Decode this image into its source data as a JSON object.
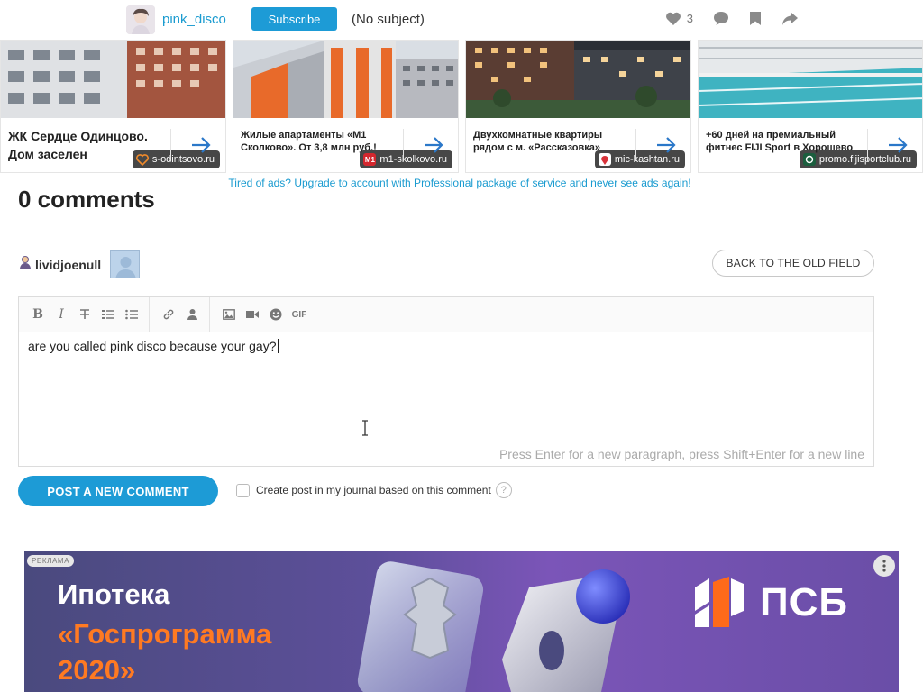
{
  "topbar": {
    "username": "pink_disco",
    "subscribe_label": "Subscribe",
    "subject": "(No subject)",
    "likes_count": "3"
  },
  "ads": [
    {
      "image": "building-facade",
      "source": "s-odintsovo.ru",
      "source_icon": "heart-outline-icon",
      "title": "ЖК Сердце Одинцово. Дом заселен"
    },
    {
      "image": "orange-buildings",
      "source": "m1-skolkovo.ru",
      "source_icon": "M1",
      "title": "Жилые апартаменты «М1 Сколково». От 3,8 млн руб.!"
    },
    {
      "image": "evening-courtyard",
      "source": "mic-kashtan.ru",
      "source_icon": "pin-icon",
      "title": "Двухкомнатные квартиры рядом с м. «Рассказовка»"
    },
    {
      "image": "swimming-pool",
      "source": "promo.fijisportclub.ru",
      "source_icon": "fiji-logo-icon",
      "title": "+60 дней на премиальный фитнес FIJI Sport в Хорошево"
    }
  ],
  "upgrade_text": "Tired of ads? Upgrade to account with Professional package of service and never see ads again!",
  "comments": {
    "heading": "0 comments"
  },
  "composer": {
    "author": "lividjoenull",
    "back_label": "BACK TO THE OLD FIELD",
    "toolbar": {
      "bold": "B",
      "italic": "I",
      "strike": "T",
      "gif": "GIF"
    },
    "text": "are you called pink disco because your gay?",
    "hint": "Press Enter for a new paragraph, press Shift+Enter for a new line",
    "post_label": "POST A NEW COMMENT",
    "checkbox_label": "Create post in my journal based on this comment",
    "help": "?"
  },
  "banner": {
    "tag": "РЕКЛАМА",
    "line1": "Ипотека",
    "line2": "«Госпрограмма 2020»",
    "brand": "ПСБ",
    "accent": "#ff7a22"
  },
  "colors": {
    "link": "#1a9bd0",
    "button": "#1d9bd6",
    "arrow": "#2b78c9"
  }
}
